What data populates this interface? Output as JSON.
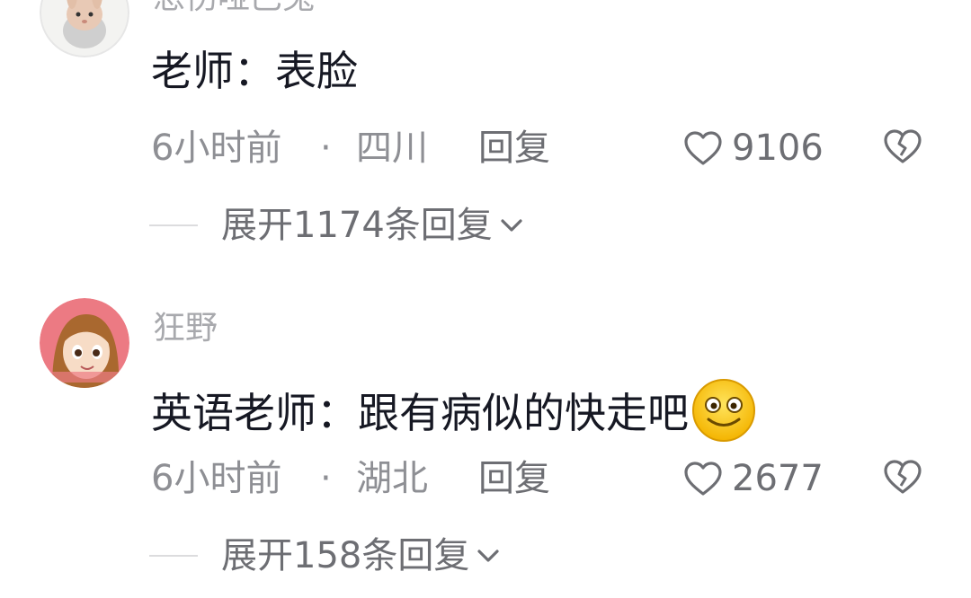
{
  "comments": [
    {
      "username": "悲伤哑巴兔",
      "text": "老师：表脸",
      "time": "6小时前",
      "separator": "·",
      "region": "四川",
      "reply_label": "回复",
      "likes": "9106",
      "expand_label": "展开1174条回复",
      "avatar_icon": "bunny-avatar"
    },
    {
      "username": "狂野",
      "text": "英语老师：跟有病似的快走吧",
      "emoji_icon": "smiling-face-emoji",
      "time": "6小时前",
      "separator": "·",
      "region": "湖北",
      "reply_label": "回复",
      "likes": "2677",
      "expand_label": "展开158条回复",
      "avatar_icon": "cartoon-girl-avatar"
    }
  ],
  "icons": {
    "like": "heart-outline-icon",
    "dislike": "broken-heart-icon",
    "expand": "chevron-down-icon"
  },
  "colors": {
    "text": "#161823",
    "muted": "#8e8f94",
    "username": "#a8a9ad",
    "background": "#ffffff"
  }
}
